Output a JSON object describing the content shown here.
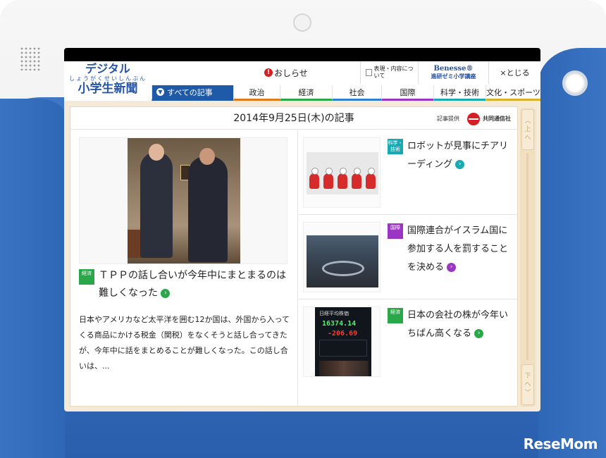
{
  "header": {
    "logo_line1": "デジタル",
    "logo_ruby": "しょうがくせいしんぶん",
    "logo_line2": "小学生新聞",
    "notice": "おしらせ",
    "about": "表現・内容について",
    "benesse_line1": "Benesse®",
    "benesse_line2": "進研ゼミ小学講座",
    "close": "×とじる"
  },
  "nav": {
    "items": [
      {
        "label": "すべての記事",
        "color": "#1e5aa8"
      },
      {
        "label": "政治",
        "color": "#e07b1a"
      },
      {
        "label": "経済",
        "color": "#2aa748"
      },
      {
        "label": "社会",
        "color": "#2f7fd1"
      },
      {
        "label": "国際",
        "color": "#9a36c3"
      },
      {
        "label": "科学・技術",
        "color": "#18a9b2"
      },
      {
        "label": "文化・スポーツ",
        "color": "#d8b12a"
      }
    ]
  },
  "content": {
    "date_title": "2014年9月25日(木)の記事",
    "provided_by": "記事提供",
    "provider": "共同通信社"
  },
  "main_article": {
    "category": "経済",
    "headline": "ＴＰＰの話し合いが今年中にまとまるのは難しくなった",
    "summary": "日本やアメリカなど太平洋を囲む12か国は、外国から入ってくる商品にかける税金（関税）をなくそうと話し合ってきたが、今年中に話をまとめることが難しくなった。この話し合いは、..."
  },
  "side_articles": [
    {
      "category": "科学・技術",
      "headline": "ロボットが見事にチアリーディング"
    },
    {
      "category": "国際",
      "headline": "国際連合がイスラム国に参加する人を罰することを決める"
    },
    {
      "category": "経済",
      "headline": "日本の会社の株が今年いちばん高くなる"
    }
  ],
  "stock_photo": {
    "title": "日経平均株価",
    "value": "16374.14",
    "change": "-206.69"
  },
  "rail": {
    "up": "上へ",
    "down": "下へ"
  },
  "watermark": "ReseMom"
}
